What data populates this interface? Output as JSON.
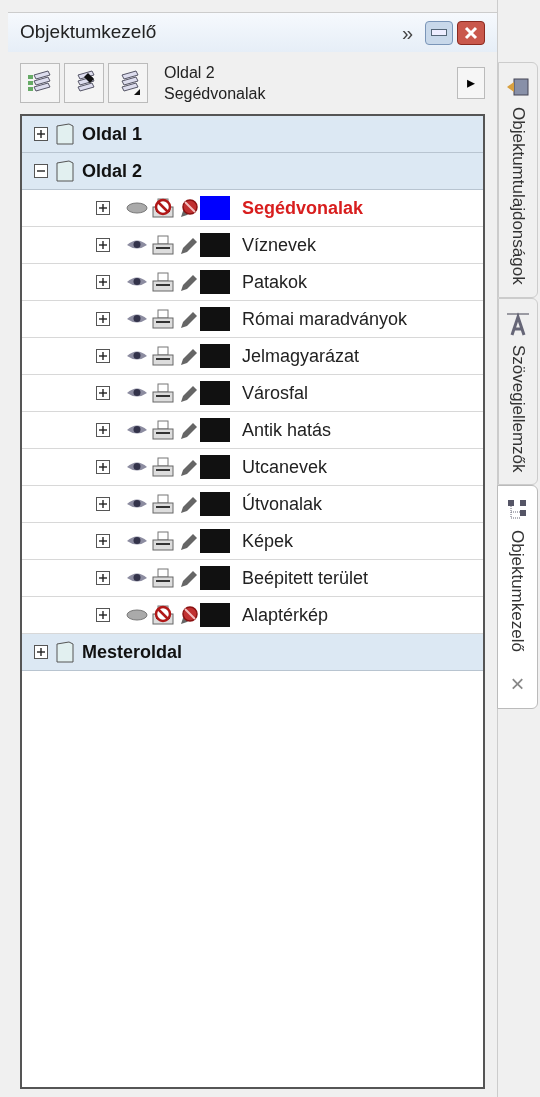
{
  "panel": {
    "title": "Objektumkezelő",
    "expand_glyph": "»"
  },
  "toolbar": {
    "page": "Oldal 2",
    "layer": "Segédvonalak",
    "arrow": "▸"
  },
  "tree": [
    {
      "label": "Oldal 1",
      "expanded": false
    },
    {
      "label": "Oldal 2",
      "expanded": true,
      "layers": [
        {
          "name": "Segédvonalak",
          "visible": false,
          "printable": false,
          "editable": false,
          "color": "#0000ff",
          "active": true
        },
        {
          "name": "Víznevek",
          "visible": true,
          "printable": true,
          "editable": true,
          "color": "#111111",
          "active": false
        },
        {
          "name": "Patakok",
          "visible": true,
          "printable": true,
          "editable": true,
          "color": "#111111",
          "active": false
        },
        {
          "name": "Római maradványok",
          "visible": true,
          "printable": true,
          "editable": true,
          "color": "#111111",
          "active": false
        },
        {
          "name": "Jelmagyarázat",
          "visible": true,
          "printable": true,
          "editable": true,
          "color": "#111111",
          "active": false
        },
        {
          "name": "Városfal",
          "visible": true,
          "printable": true,
          "editable": true,
          "color": "#111111",
          "active": false
        },
        {
          "name": "Antik hatás",
          "visible": true,
          "printable": true,
          "editable": true,
          "color": "#111111",
          "active": false
        },
        {
          "name": "Utcanevek",
          "visible": true,
          "printable": true,
          "editable": true,
          "color": "#111111",
          "active": false
        },
        {
          "name": "Útvonalak",
          "visible": true,
          "printable": true,
          "editable": true,
          "color": "#111111",
          "active": false
        },
        {
          "name": "Képek",
          "visible": true,
          "printable": true,
          "editable": true,
          "color": "#111111",
          "active": false
        },
        {
          "name": "Beépitett terület",
          "visible": true,
          "printable": true,
          "editable": true,
          "color": "#111111",
          "active": false
        },
        {
          "name": "Alaptérkép",
          "visible": false,
          "printable": false,
          "editable": false,
          "color": "#111111",
          "active": false
        }
      ]
    },
    {
      "label": "Mesteroldal",
      "expanded": false
    }
  ],
  "side_tabs": [
    {
      "label": "Objektumtulajdonságok",
      "selected": false,
      "kind": "properties"
    },
    {
      "label": "Szövegjellemzők",
      "selected": false,
      "kind": "text"
    },
    {
      "label": "Objektumkezelő",
      "selected": true,
      "kind": "manager",
      "close": "×"
    }
  ]
}
